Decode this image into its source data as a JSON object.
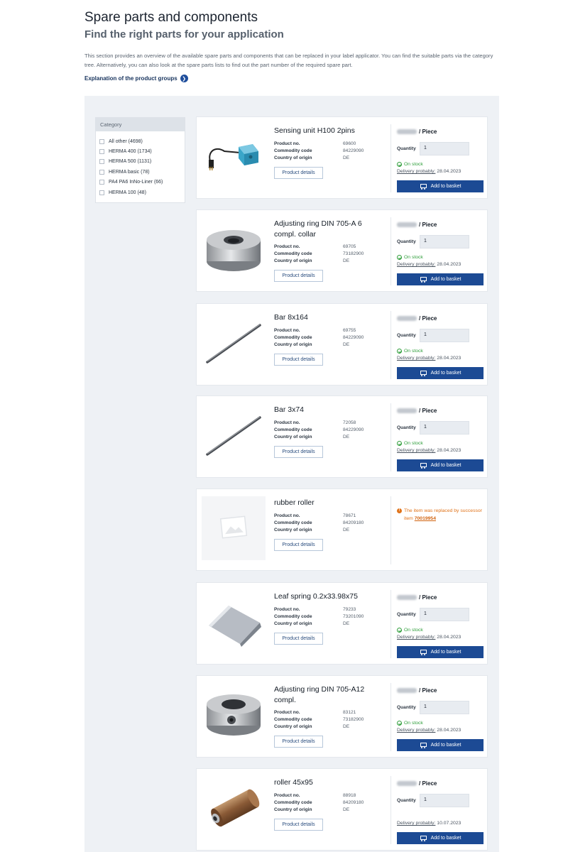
{
  "header": {
    "title": "Spare parts and components",
    "subtitle": "Find the right parts for your application",
    "intro": "This section provides an overview of the available spare parts and components that can be replaced in your label applicator. You can find the suitable parts via the category tree. Alternatively, you can also look at the spare parts lists to find out the part number of the required spare part.",
    "link": "Explanation of the product groups"
  },
  "sidebar": {
    "title": "Category",
    "items": [
      {
        "label": "All other (4698)"
      },
      {
        "label": "HERMA 400 (1734)"
      },
      {
        "label": "HERMA 500 (1131)"
      },
      {
        "label": "HERMA basic (78)"
      },
      {
        "label": "PA4 PA6 InNo-Liner (66)"
      },
      {
        "label": "HERMA 100 (48)"
      }
    ]
  },
  "labels": {
    "product_no": "Product no.",
    "commodity": "Commodity code",
    "origin": "Country of origin",
    "details_btn": "Product details",
    "quantity": "Quantity",
    "on_stock": "On stock",
    "delivery": "Delivery probably:",
    "basket": "Add to basket",
    "price_unit": "/ Piece",
    "replaced": "The item was replaced by successor item"
  },
  "products": [
    {
      "name": "Sensing unit H100 2pins",
      "product_no": "69600",
      "commodity": "84229090",
      "origin": "DE",
      "qty": "1",
      "delivery": "28.04.2023",
      "on_stock": true,
      "image": "sensor-image"
    },
    {
      "name": "Adjusting ring DIN 705-A 6 compl. collar",
      "product_no": "69705",
      "commodity": "73182900",
      "origin": "DE",
      "qty": "1",
      "delivery": "28.04.2023",
      "on_stock": true,
      "image": "ring-image"
    },
    {
      "name": "Bar 8x164",
      "product_no": "69755",
      "commodity": "84229090",
      "origin": "DE",
      "qty": "1",
      "delivery": "28.04.2023",
      "on_stock": true,
      "image": "bar-image"
    },
    {
      "name": "Bar 3x74",
      "product_no": "72058",
      "commodity": "84229090",
      "origin": "DE",
      "qty": "1",
      "delivery": "28.04.2023",
      "on_stock": true,
      "image": "bar-image"
    },
    {
      "name": "rubber roller",
      "product_no": "78671",
      "commodity": "84209180",
      "origin": "DE",
      "replaced_by": "70019954",
      "image": "placeholder-image"
    },
    {
      "name": "Leaf spring 0.2x33.98x75",
      "product_no": "79233",
      "commodity": "73201090",
      "origin": "DE",
      "qty": "1",
      "delivery": "28.04.2023",
      "on_stock": true,
      "image": "spring-image"
    },
    {
      "name": "Adjusting ring DIN 705-A12 compl.",
      "product_no": "83121",
      "commodity": "73182900",
      "origin": "DE",
      "qty": "1",
      "delivery": "28.04.2023",
      "on_stock": true,
      "image": "ring-screw-image"
    },
    {
      "name": "roller 45x95",
      "product_no": "88918",
      "commodity": "84209180",
      "origin": "DE",
      "qty": "1",
      "delivery": "10.07.2023",
      "on_stock": false,
      "image": "roller-image"
    }
  ],
  "colors": {
    "accent": "#1c4a94",
    "stock_green": "#2e9e3a",
    "warning_orange": "#e0731a",
    "panel_bg": "#eef1f5"
  }
}
